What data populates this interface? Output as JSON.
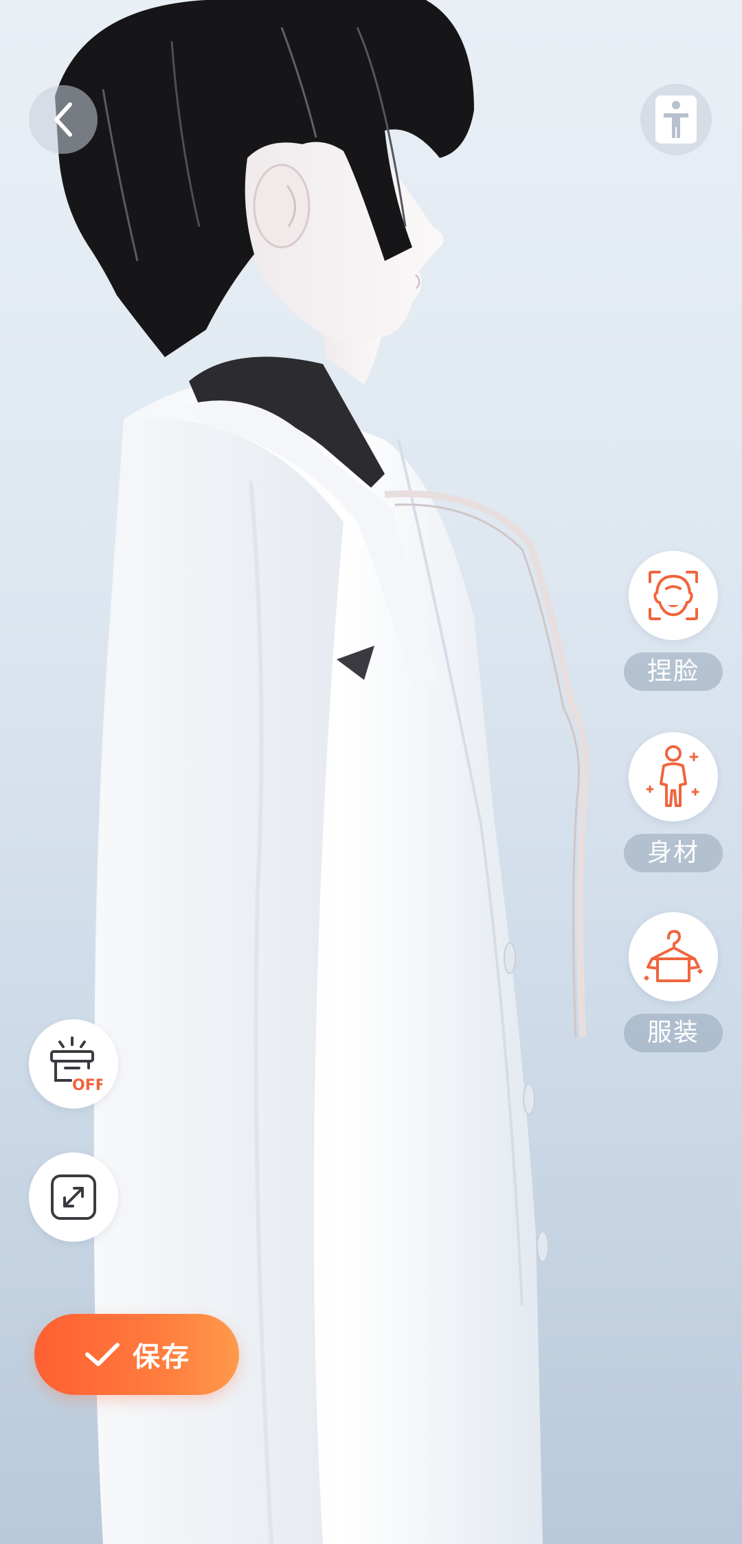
{
  "tools": {
    "face": {
      "label": "捏脸",
      "icon": "face-icon"
    },
    "body": {
      "label": "身材",
      "icon": "body-figure-icon"
    },
    "outfit": {
      "label": "服装",
      "icon": "hanger-icon"
    }
  },
  "scene_toggle": {
    "badge": "OFF",
    "icon": "lamp-off-icon"
  },
  "expand": {
    "icon": "expand-icon"
  },
  "save": {
    "label": "保存",
    "icon": "check-icon"
  },
  "nav": {
    "back_icon": "chevron-left-icon",
    "pose_icon": "person-pose-icon"
  },
  "colors": {
    "accent": "#ff6b3d",
    "icon_orange": "#f0653c",
    "label_bg": "#a3b1c2"
  }
}
